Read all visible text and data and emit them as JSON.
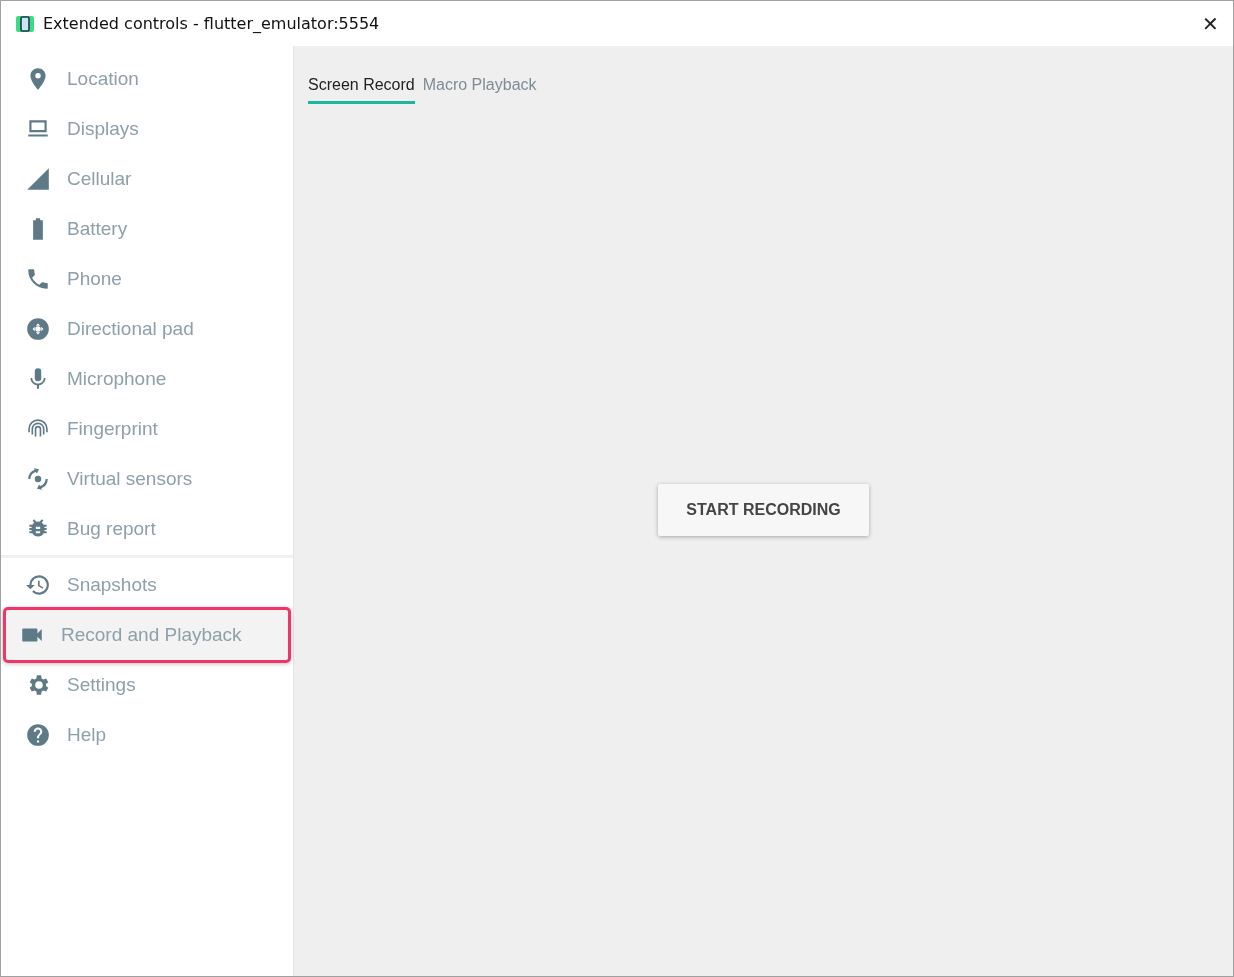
{
  "window": {
    "title": "Extended controls - flutter_emulator:5554",
    "close": "✕"
  },
  "sidebar": {
    "groups": [
      {
        "items": [
          {
            "label": "Location",
            "selected": false
          },
          {
            "label": "Displays",
            "selected": false
          },
          {
            "label": "Cellular",
            "selected": false
          },
          {
            "label": "Battery",
            "selected": false
          },
          {
            "label": "Phone",
            "selected": false
          },
          {
            "label": "Directional pad",
            "selected": false
          },
          {
            "label": "Microphone",
            "selected": false
          },
          {
            "label": "Fingerprint",
            "selected": false
          },
          {
            "label": "Virtual sensors",
            "selected": false
          },
          {
            "label": "Bug report",
            "selected": false
          }
        ]
      },
      {
        "items": [
          {
            "label": "Snapshots",
            "selected": false
          },
          {
            "label": "Record and Playback",
            "selected": true
          },
          {
            "label": "Settings",
            "selected": false
          },
          {
            "label": "Help",
            "selected": false
          }
        ]
      }
    ]
  },
  "tabs": [
    {
      "label": "Screen Record",
      "selected": true
    },
    {
      "label": "Macro Playback",
      "selected": false
    }
  ],
  "start_button": "START RECORDING"
}
